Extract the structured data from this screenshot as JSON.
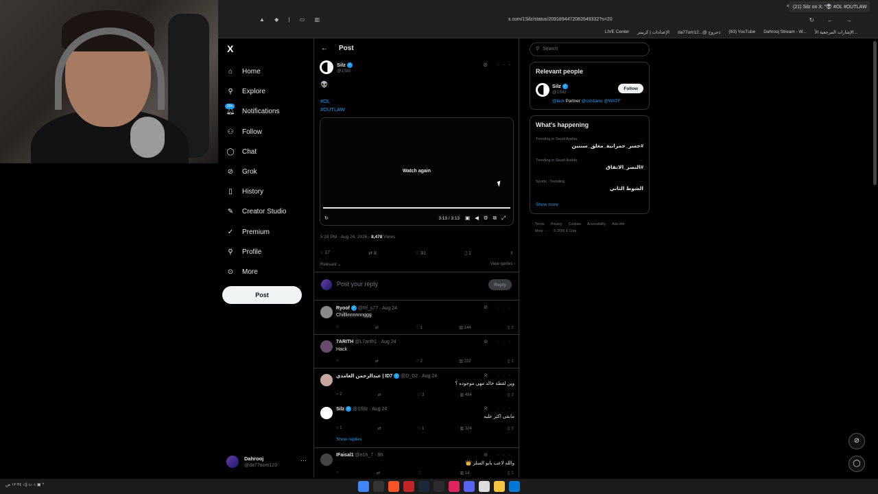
{
  "browser": {
    "tab_title": "(21) Silz on X: \"👽 #OL #OUTLAW",
    "url": "x.com/1Silz/status/2091894472082649332?s=20",
    "bookmarks": [
      "LIVE Center",
      "الإعدادات | كرييتر",
      "da77om12...@ ذحروج",
      "(63) YouTube",
      "Dahrooj Stream - W...",
      "الإشارات المرجعية الأ..."
    ]
  },
  "nav": {
    "logo": "X",
    "items": [
      {
        "label": "Home",
        "icon": "home-icon"
      },
      {
        "label": "Explore",
        "icon": "search-icon"
      },
      {
        "label": "Notifications",
        "icon": "bell-icon"
      },
      {
        "label": "Follow",
        "icon": "follow-icon"
      },
      {
        "label": "Chat",
        "icon": "chat-icon"
      },
      {
        "label": "Grok",
        "icon": "grok-icon"
      },
      {
        "label": "History",
        "icon": "bookmark-icon"
      },
      {
        "label": "Creator Studio",
        "icon": "creator-icon"
      },
      {
        "label": "Premium",
        "icon": "premium-icon"
      },
      {
        "label": "Profile",
        "icon": "profile-icon"
      },
      {
        "label": "More",
        "icon": "more-icon"
      }
    ],
    "notifications_badge": "20+",
    "post_button": "Post",
    "account": {
      "name": "Dahrooj",
      "handle": "@da77oom123"
    }
  },
  "post": {
    "header": "Post",
    "author": "Silz",
    "handle": "@1Silz",
    "emoji": "👽",
    "hashtags": [
      "#OL",
      "#OUTLAW"
    ],
    "video": {
      "watch_again": "Watch again",
      "time": "3:13 / 3:13",
      "progress": 1.0
    },
    "timestamp": "5:24 PM · Aug 24, 2026 · ",
    "views_count": "8,478",
    "views_label": " Views",
    "counts": {
      "replies": "17",
      "reposts": "8",
      "likes": "81",
      "bookmarks": "1"
    },
    "relevant": "Relevant",
    "view_quotes": "View quotes",
    "reply_placeholder": "Post your reply",
    "reply_button": "Reply"
  },
  "comments": [
    {
      "name": "Ryoof",
      "handle": "@Rf_s77",
      "date": "Aug 24",
      "text": "Chilllinnnnnnggg",
      "rtl": false,
      "counts": [
        "",
        "",
        "1",
        "144"
      ]
    },
    {
      "name": "7ARITH",
      "handle": "@L7arith1",
      "date": "Aug 24",
      "text": "Hack",
      "rtl": false,
      "counts": [
        "",
        "",
        "2",
        "222"
      ]
    },
    {
      "name": "عبدالرحمن الغامدي | ID7",
      "handle": "@D_D2",
      "date": "Aug 24",
      "text": "وين لقطة خالد مهي موجوده ؟",
      "rtl": true,
      "counts": [
        "2",
        "",
        "3",
        "494"
      ]
    },
    {
      "name": "Silz",
      "handle": "@1Silz",
      "date": "Aug 24",
      "text": "مابقى اكثر عليه",
      "rtl": true,
      "counts": [
        "1",
        "",
        "1",
        "324"
      ]
    },
    {
      "name": "IFaisal1",
      "handle": "@e1h_7",
      "date": "8h",
      "text": "والله لاعب يابو السلز 👑",
      "rtl": true,
      "counts": [
        "",
        "",
        "",
        "14"
      ]
    }
  ],
  "show_replies": "Show replies",
  "sidebar": {
    "search_placeholder": "Search",
    "relevant_title": "Relevant people",
    "person": {
      "name": "Silz",
      "handle": "@1Silz",
      "follow": "Follow",
      "bio_link1": "@kick",
      "bio_text": " Partner ",
      "bio_link2": "@cristiano @WATF"
    },
    "happening_title": "What's happening",
    "trends": [
      {
        "context": "Trending in Saudi Arabia",
        "topic": "#جسر_جمرانية_مغلق_سنتين"
      },
      {
        "context": "Trending in Saudi Arabia",
        "topic": "#النصر_الاتفاق"
      },
      {
        "context": "Sports · Trending",
        "topic": "الشوط الثاني"
      }
    ],
    "show_more": "Show more",
    "footer": [
      "Terms",
      "Privacy",
      "Cookies",
      "Accessibility",
      "Ads info",
      "More ···",
      "© 2026 X Corp."
    ]
  },
  "taskbar": {
    "tray": "١٢:٣٤ ص"
  }
}
